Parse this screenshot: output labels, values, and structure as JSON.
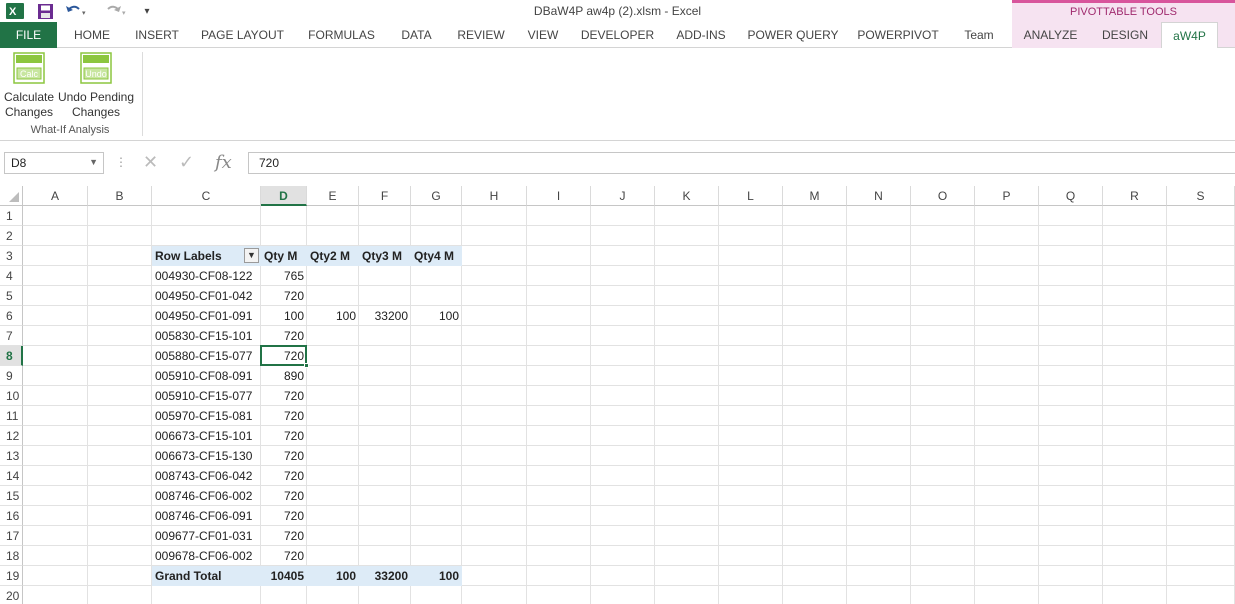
{
  "window": {
    "title": "DBaW4P aw4p (2).xlsm - Excel",
    "context_header": "PIVOTTABLE TOOLS",
    "accent": "#217346",
    "context_color": "#d8559c"
  },
  "quick_access": {
    "app_icon": "excel-icon",
    "save_icon": "save-icon",
    "undo_icon": "undo-icon",
    "redo_icon": "redo-icon",
    "customize_icon": "customize-qat-icon"
  },
  "tabs": [
    "FILE",
    "HOME",
    "INSERT",
    "PAGE LAYOUT",
    "FORMULAS",
    "DATA",
    "REVIEW",
    "VIEW",
    "DEVELOPER",
    "ADD-INS",
    "POWER QUERY",
    "POWERPIVOT",
    "Team",
    "ANALYZE",
    "DESIGN",
    "aW4P"
  ],
  "ribbon": {
    "buttons": [
      {
        "line1": "Calculate",
        "line2": "Changes",
        "icon_text": "Calc"
      },
      {
        "line1": "Undo Pending",
        "line2": "Changes",
        "icon_text": "Undo"
      }
    ],
    "group_label": "What-If Analysis"
  },
  "formula_bar": {
    "name_box": "D8",
    "formula": "720",
    "fx": "fx"
  },
  "columns": [
    "A",
    "B",
    "C",
    "D",
    "E",
    "F",
    "G",
    "H",
    "I",
    "J",
    "K",
    "L",
    "M",
    "N",
    "O",
    "P",
    "Q",
    "R",
    "S"
  ],
  "rows": [
    "1",
    "2",
    "3",
    "4",
    "5",
    "6",
    "7",
    "8",
    "9",
    "10",
    "11",
    "12",
    "13",
    "14",
    "15",
    "16",
    "17",
    "18",
    "19",
    "20"
  ],
  "pivot": {
    "headers": [
      "Row Labels",
      "Qty M",
      "Qty2 M",
      "Qty3 M",
      "Qty4 M"
    ],
    "rows": [
      [
        "004930-CF08-122",
        "765",
        "",
        "",
        ""
      ],
      [
        "004950-CF01-042",
        "720",
        "",
        "",
        ""
      ],
      [
        "004950-CF01-091",
        "100",
        "100",
        "33200",
        "100"
      ],
      [
        "005830-CF15-101",
        "720",
        "",
        "",
        ""
      ],
      [
        "005880-CF15-077",
        "720",
        "",
        "",
        ""
      ],
      [
        "005910-CF08-091",
        "890",
        "",
        "",
        ""
      ],
      [
        "005910-CF15-077",
        "720",
        "",
        "",
        ""
      ],
      [
        "005970-CF15-081",
        "720",
        "",
        "",
        ""
      ],
      [
        "006673-CF15-101",
        "720",
        "",
        "",
        ""
      ],
      [
        "006673-CF15-130",
        "720",
        "",
        "",
        ""
      ],
      [
        "008743-CF06-042",
        "720",
        "",
        "",
        ""
      ],
      [
        "008746-CF06-002",
        "720",
        "",
        "",
        ""
      ],
      [
        "008746-CF06-091",
        "720",
        "",
        "",
        ""
      ],
      [
        "009677-CF01-031",
        "720",
        "",
        "",
        ""
      ],
      [
        "009678-CF06-002",
        "720",
        "",
        "",
        ""
      ]
    ],
    "grand_total": [
      "Grand Total",
      "10405",
      "100",
      "33200",
      "100"
    ]
  }
}
